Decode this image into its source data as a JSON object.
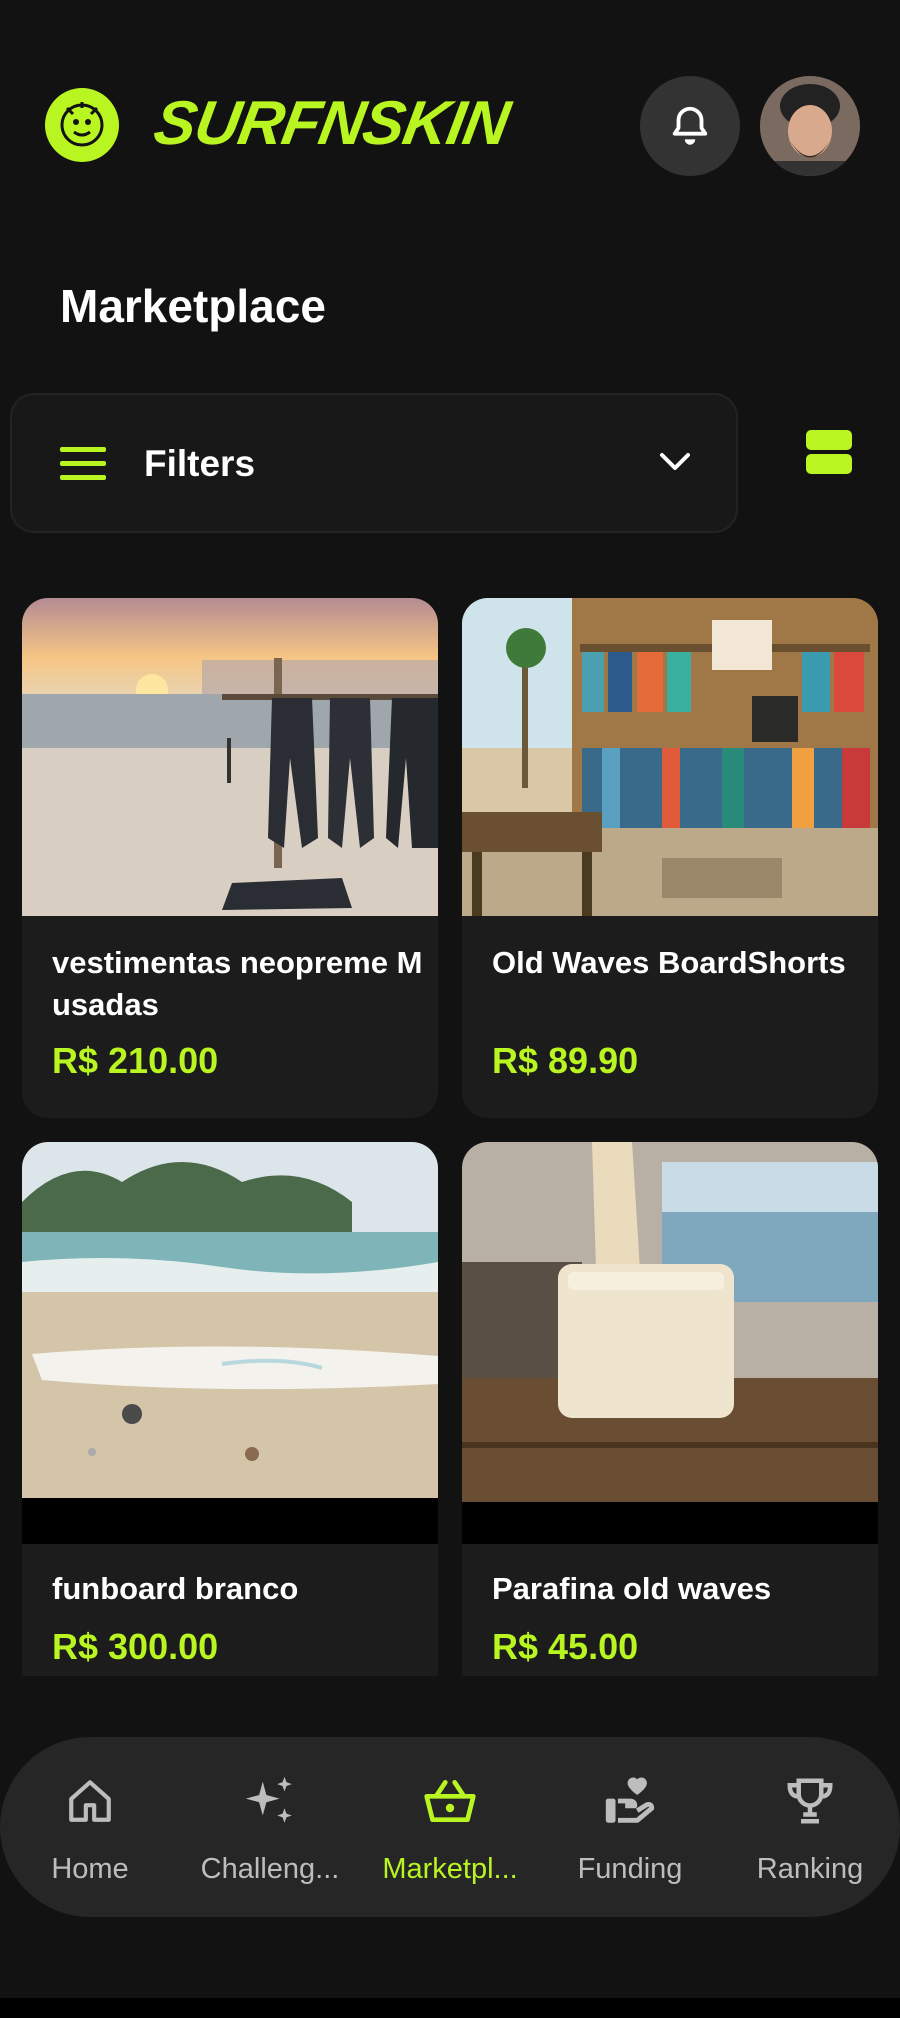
{
  "header": {
    "brand": "SURFNSKIN",
    "accent": "#b9f521"
  },
  "page": {
    "title": "Marketplace"
  },
  "filters": {
    "label": "Filters"
  },
  "products": [
    {
      "name": "vestimentas neopreme M usadas",
      "price": "R$ 210.00"
    },
    {
      "name": "Old Waves BoardShorts",
      "price": "R$ 89.90"
    },
    {
      "name": "funboard branco",
      "price": "R$ 300.00"
    },
    {
      "name": "Parafina old waves",
      "price": "R$ 45.00"
    }
  ],
  "nav": {
    "items": [
      {
        "label": "Home",
        "icon": "home-icon"
      },
      {
        "label": "Challeng...",
        "icon": "sparkles-icon"
      },
      {
        "label": "Marketpl...",
        "icon": "basket-icon",
        "active": true
      },
      {
        "label": "Funding",
        "icon": "heart-hand-icon"
      },
      {
        "label": "Ranking",
        "icon": "trophy-icon"
      }
    ]
  }
}
